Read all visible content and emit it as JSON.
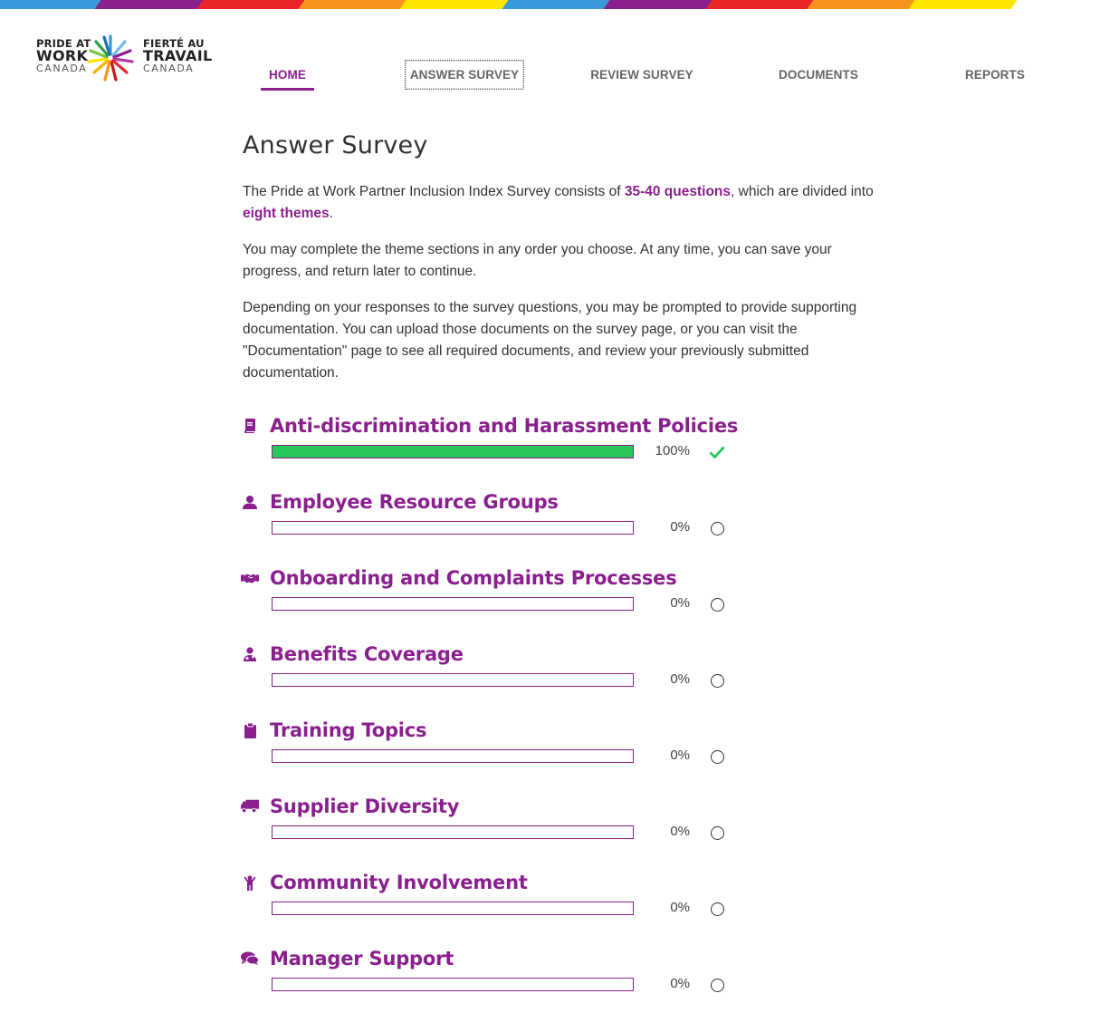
{
  "colors": {
    "accent": "#8a1f8e",
    "complete": "#28c85a",
    "rainbow": [
      "#3a9ad9",
      "#8a1f8e",
      "#e8262a",
      "#f7941d",
      "#ffe600",
      "#3a9ad9",
      "#8a1f8e",
      "#e8262a",
      "#f7941d",
      "#ffe600",
      "#ffffff"
    ]
  },
  "logo": {
    "left_line1": "PRIDE AT",
    "left_line2": "WORK",
    "left_line3": "CANADA",
    "right_line1": "FIERTÉ AU",
    "right_line2": "TRAVAIL",
    "right_line3": "CANADA"
  },
  "nav": {
    "items": [
      {
        "label": "HOME",
        "active": true
      },
      {
        "label": "ANSWER SURVEY",
        "focused": true
      },
      {
        "label": "REVIEW SURVEY"
      },
      {
        "label": "DOCUMENTS"
      },
      {
        "label": "REPORTS"
      }
    ]
  },
  "page": {
    "title": "Answer Survey",
    "intro": {
      "p1_a": "The Pride at Work Partner Inclusion Index Survey consists of ",
      "p1_b": "35-40 questions",
      "p1_c": ", which are divided into ",
      "p1_d": "eight themes",
      "p1_e": ".",
      "p2": "You may complete the theme sections in any order you choose. At any time, you can save your progress, and return later to continue.",
      "p3": "Depending on your responses to the survey questions, you may be prompted to provide supporting documentation. You can upload those documents on the survey page, or you can visit the \"Documentation\" page to see all required documents, and review your previously submitted documentation."
    }
  },
  "themes": [
    {
      "title": "Anti-discrimination and Harassment Policies",
      "icon": "book-icon",
      "progress": 100,
      "progress_label": "100%",
      "status": "check-icon"
    },
    {
      "title": "Employee Resource Groups",
      "icon": "user-icon",
      "progress": 0,
      "progress_label": "0%",
      "status": "circle-icon"
    },
    {
      "title": "Onboarding and Complaints Processes",
      "icon": "handshake-icon",
      "progress": 0,
      "progress_label": "0%",
      "status": "circle-icon"
    },
    {
      "title": "Benefits Coverage",
      "icon": "user-md-icon",
      "progress": 0,
      "progress_label": "0%",
      "status": "circle-icon"
    },
    {
      "title": "Training Topics",
      "icon": "clipboard-icon",
      "progress": 0,
      "progress_label": "0%",
      "status": "circle-icon"
    },
    {
      "title": "Supplier Diversity",
      "icon": "truck-icon",
      "progress": 0,
      "progress_label": "0%",
      "status": "circle-icon"
    },
    {
      "title": "Community Involvement",
      "icon": "child-icon",
      "progress": 0,
      "progress_label": "0%",
      "status": "circle-icon"
    },
    {
      "title": "Manager Support",
      "icon": "comments-icon",
      "progress": 0,
      "progress_label": "0%",
      "status": "circle-icon"
    }
  ]
}
